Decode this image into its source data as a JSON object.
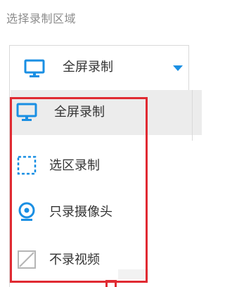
{
  "section_label": "选择录制区域",
  "select": {
    "value": "全屏录制",
    "icon": "monitor-icon",
    "caret_icon": "caret-down-icon"
  },
  "options": [
    {
      "label": "全屏录制",
      "icon": "monitor-icon",
      "selected": true
    },
    {
      "label": "选区录制",
      "icon": "dashed-square-icon",
      "selected": false
    },
    {
      "label": "只录摄像头",
      "icon": "webcam-icon",
      "selected": false
    },
    {
      "label": "不录视频",
      "icon": "no-video-icon",
      "selected": false
    }
  ],
  "colors": {
    "accent": "#1a8fe3",
    "highlight": "#e02a32",
    "selected_bg": "#ececec",
    "border": "#d9d9d9"
  }
}
